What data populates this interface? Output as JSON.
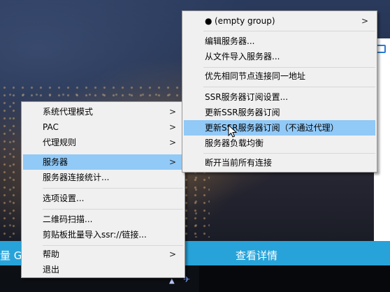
{
  "background": {
    "bottom_left_text": "量 Go",
    "bottom_center_text": "查看详情"
  },
  "context_menu": {
    "items": [
      {
        "label": "系统代理模式",
        "has_submenu": true
      },
      {
        "label": "PAC",
        "has_submenu": true
      },
      {
        "label": "代理规则",
        "has_submenu": true
      },
      {
        "label": "服务器",
        "has_submenu": true,
        "highlighted": true
      },
      {
        "label": "服务器连接统计..."
      },
      {
        "label": "选项设置..."
      },
      {
        "label": "二维码扫描..."
      },
      {
        "label": "剪贴板批量导入ssr://链接..."
      },
      {
        "label": "帮助",
        "has_submenu": true
      },
      {
        "label": "退出"
      }
    ]
  },
  "servers_submenu": {
    "items": [
      {
        "label": "(empty group)",
        "bullet": "●",
        "has_submenu": true
      },
      {
        "label": "编辑服务器..."
      },
      {
        "label": "从文件导入服务器..."
      },
      {
        "label": "优先相同节点连接同一地址"
      },
      {
        "label": "SSR服务器订阅设置..."
      },
      {
        "label": "更新SSR服务器订阅"
      },
      {
        "label": "更新SSR服务器订阅（不通过代理）",
        "highlighted": true
      },
      {
        "label": "服务器负载均衡"
      },
      {
        "label": "断开当前所有连接"
      }
    ]
  },
  "submenu_arrow": ">",
  "colors": {
    "highlight": "#91c9f7",
    "accent_bar": "#27a3d9",
    "menu_bg": "#f0f0f0"
  }
}
